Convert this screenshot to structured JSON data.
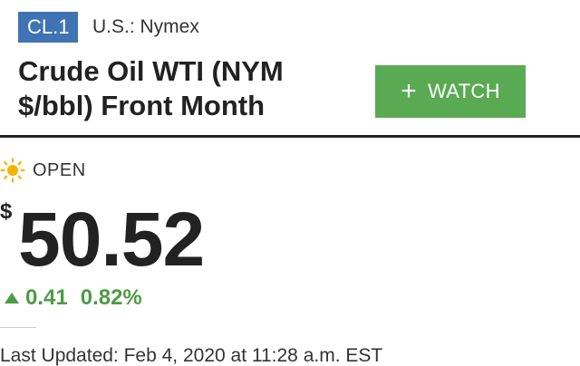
{
  "ticker": "CL.1",
  "exchange": "U.S.: Nymex",
  "title": "Crude Oil WTI (NYM $/bbl) Front Month",
  "watch_button": {
    "icon": "plus-icon",
    "label": "WATCH"
  },
  "market_status": {
    "icon": "sun-icon",
    "label": "OPEN"
  },
  "quote": {
    "currency_symbol": "$",
    "price": "50.52",
    "change": "0.41",
    "change_percent": "0.82%",
    "direction_icon": "triangle-up-icon"
  },
  "last_updated": "Last Updated: Feb 4, 2020 at 11:28 a.m. EST",
  "colors": {
    "badge": "#3f73b4",
    "watch_button": "#5aaa53",
    "positive_change": "#4f9a47",
    "sun": "#f5b301"
  }
}
